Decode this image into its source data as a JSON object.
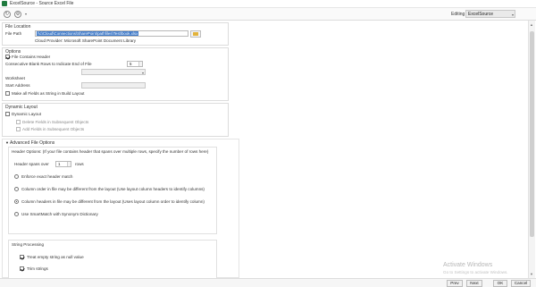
{
  "window": {
    "title": "ExcelSource - Source Excel File"
  },
  "toolbar": {
    "back_icon": "circle-arrow-icon",
    "forward_icon": "circle-settings-icon",
    "editing_label": "Editing",
    "editing_value": "ExcelSource"
  },
  "file_location": {
    "heading": "File Location",
    "path_label": "File Path",
    "path_value": "\\\\c\\Cloud\\Connections\\SharePoint\\pathfiles\\Test\\book.xlsx",
    "provider_text": "Cloud Provider: Microsoft SharePoint Document Library"
  },
  "options": {
    "heading": "Options",
    "contains_header": "File Contains Header",
    "blank_rows_label": "Consecutive Blank Rows to Indicate End of File",
    "blank_rows_value": "5",
    "worksheet_label": "Worksheet",
    "start_address_label": "Start Address",
    "make_all_string": "Make all Fields as String in Build Layout"
  },
  "dynamic_layout": {
    "heading": "Dynamic Layout",
    "dynamic_layout_label": "Dynamic Layout",
    "delete_fields": "Delete Fields in Subsequent Objects",
    "add_fields": "Add Fields in Subsequent Objects"
  },
  "advanced": {
    "heading": "Advanced File Options",
    "header_options_note": "Header Options: (If your file contains header that spans over multiple rows, specify the number of rows here)",
    "header_spans_label": "Header spans over",
    "header_spans_value": "1",
    "rows_label": "rows",
    "radio_options": [
      "Enforce exact header match",
      "Column order in file may be different from the layout (Use layout column headers to identify columns)",
      "Column headers in file may be different from the layout (Uses layout column order to identify column)",
      "Use SmartMatch with Synonym Dictionary"
    ],
    "selected_radio": 2
  },
  "string_processing": {
    "heading": "String Processing",
    "treat_empty": "Treat empty string as null value",
    "trim_strings": "Trim strings"
  },
  "watermark": {
    "line1": "Activate Windows",
    "line2": "Go to Settings to activate Windows."
  },
  "buttons": {
    "prev": "Prev",
    "next": "Next",
    "ok": "OK",
    "cancel": "Cancel"
  }
}
